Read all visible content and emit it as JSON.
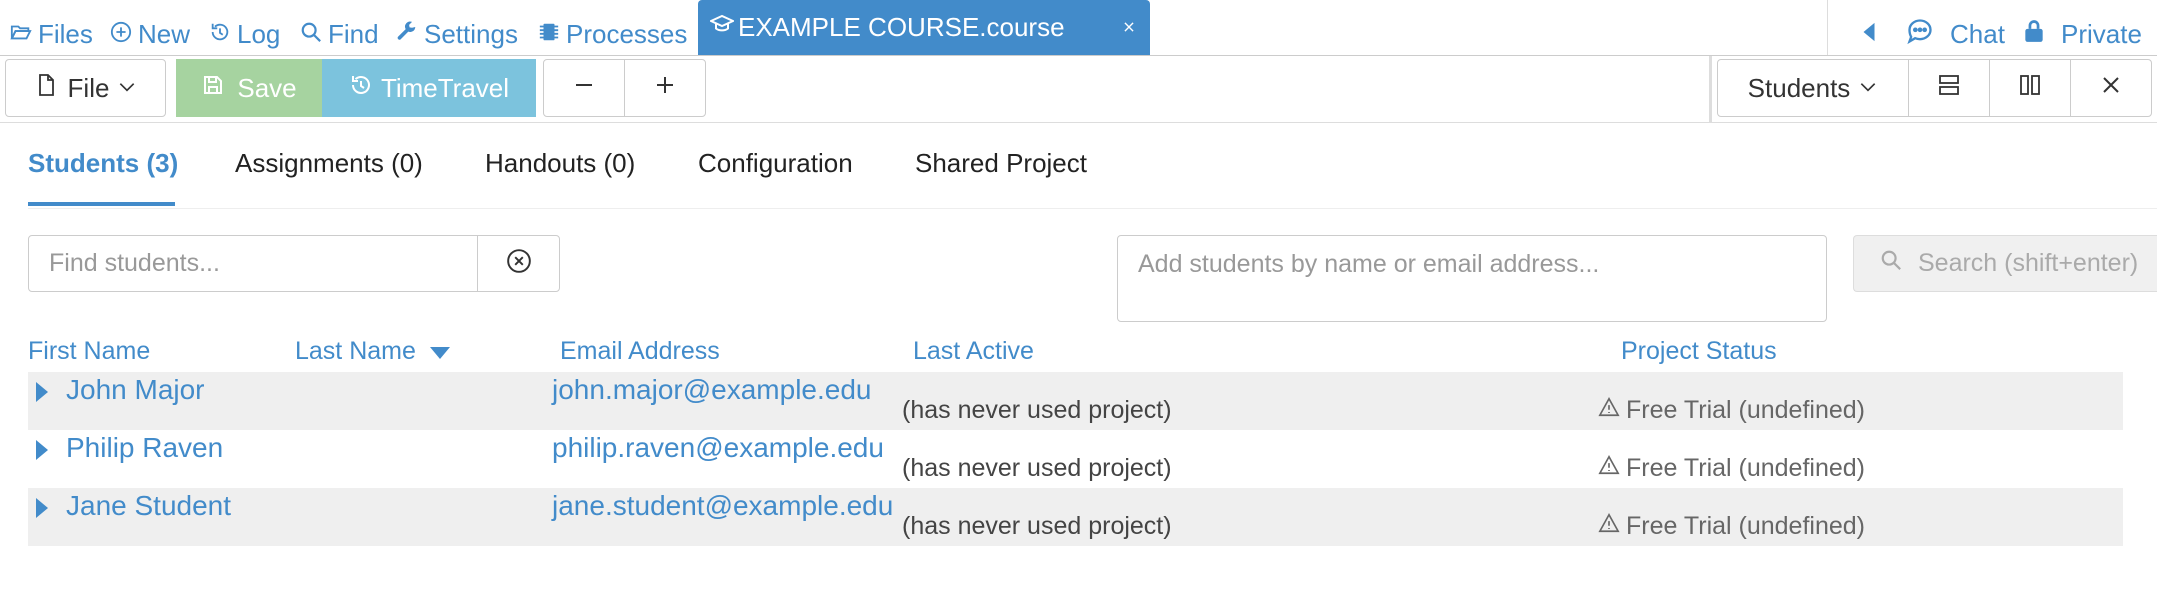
{
  "nav": {
    "files": "Files",
    "new": "New",
    "log": "Log",
    "find": "Find",
    "settings": "Settings",
    "processes": "Processes",
    "course_tab": "EXAMPLE COURSE.course",
    "chat": "Chat",
    "private": "Private"
  },
  "toolbar": {
    "file": "File",
    "save": "Save",
    "timetravel": "TimeTravel",
    "frame_select": "Students"
  },
  "tabs": [
    {
      "label": "Students (3)"
    },
    {
      "label": "Assignments (0)"
    },
    {
      "label": "Handouts (0)"
    },
    {
      "label": "Configuration"
    },
    {
      "label": "Shared Project"
    }
  ],
  "search": {
    "find_placeholder": "Find students...",
    "add_placeholder": "Add students by name or email address...",
    "search_button": "Search (shift+enter)"
  },
  "table": {
    "columns": {
      "first_name": "First Name",
      "last_name": "Last Name",
      "email": "Email Address",
      "last_active": "Last Active",
      "project_status": "Project Status"
    },
    "rows": [
      {
        "name": "John Major",
        "email": "john.major@example.edu",
        "last_active": "(has never used project)",
        "status": "Free Trial (undefined)"
      },
      {
        "name": "Philip Raven",
        "email": "philip.raven@example.edu",
        "last_active": "(has never used project)",
        "status": "Free Trial (undefined)"
      },
      {
        "name": "Jane Student",
        "email": "jane.student@example.edu",
        "last_active": "(has never used project)",
        "status": "Free Trial (undefined)"
      }
    ]
  },
  "colors": {
    "accent": "#428bca",
    "save_bg": "#a6d3a0",
    "timetravel_bg": "#7cc3dd"
  }
}
